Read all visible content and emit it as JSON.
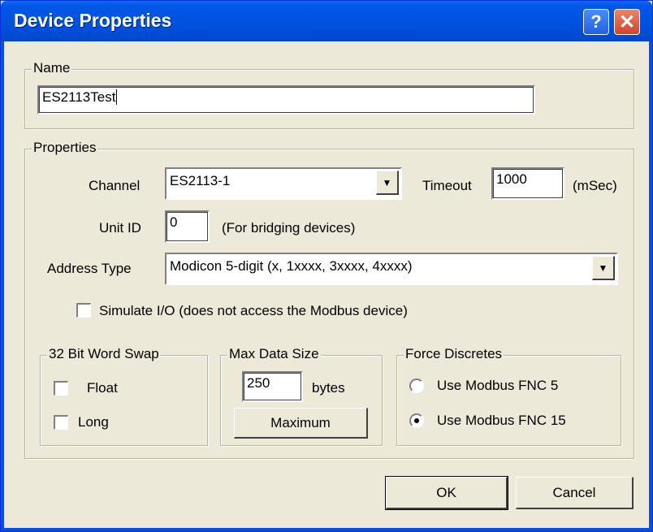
{
  "window": {
    "title": "Device Properties",
    "help_label": "?",
    "close_label": "✕"
  },
  "name_group": {
    "legend": "Name",
    "value": "ES2113Test"
  },
  "properties": {
    "legend": "Properties",
    "channel_label": "Channel",
    "channel_value": "ES2113-1",
    "timeout_label": "Timeout",
    "timeout_value": "1000",
    "timeout_unit": "(mSec)",
    "unit_id_label": "Unit ID",
    "unit_id_value": "0",
    "unit_id_hint": "(For bridging devices)",
    "address_type_label": "Address Type",
    "address_type_value": "Modicon 5-digit (x, 1xxxx, 3xxxx, 4xxxx)",
    "simulate_label": "Simulate I/O (does not access the Modbus device)",
    "simulate_checked": false
  },
  "word_swap": {
    "legend": "32 Bit Word Swap",
    "float_label": "Float",
    "float_checked": false,
    "long_label": "Long",
    "long_checked": false
  },
  "max_data": {
    "legend": "Max Data Size",
    "value": "250",
    "unit": "bytes",
    "maximum_label": "Maximum"
  },
  "force_discretes": {
    "legend": "Force Discretes",
    "fnc5_label": "Use Modbus FNC 5",
    "fnc5_selected": false,
    "fnc15_label": "Use Modbus FNC 15",
    "fnc15_selected": true
  },
  "buttons": {
    "ok_label": "OK",
    "cancel_label": "Cancel"
  },
  "icons": {
    "dropdown": "▼"
  }
}
